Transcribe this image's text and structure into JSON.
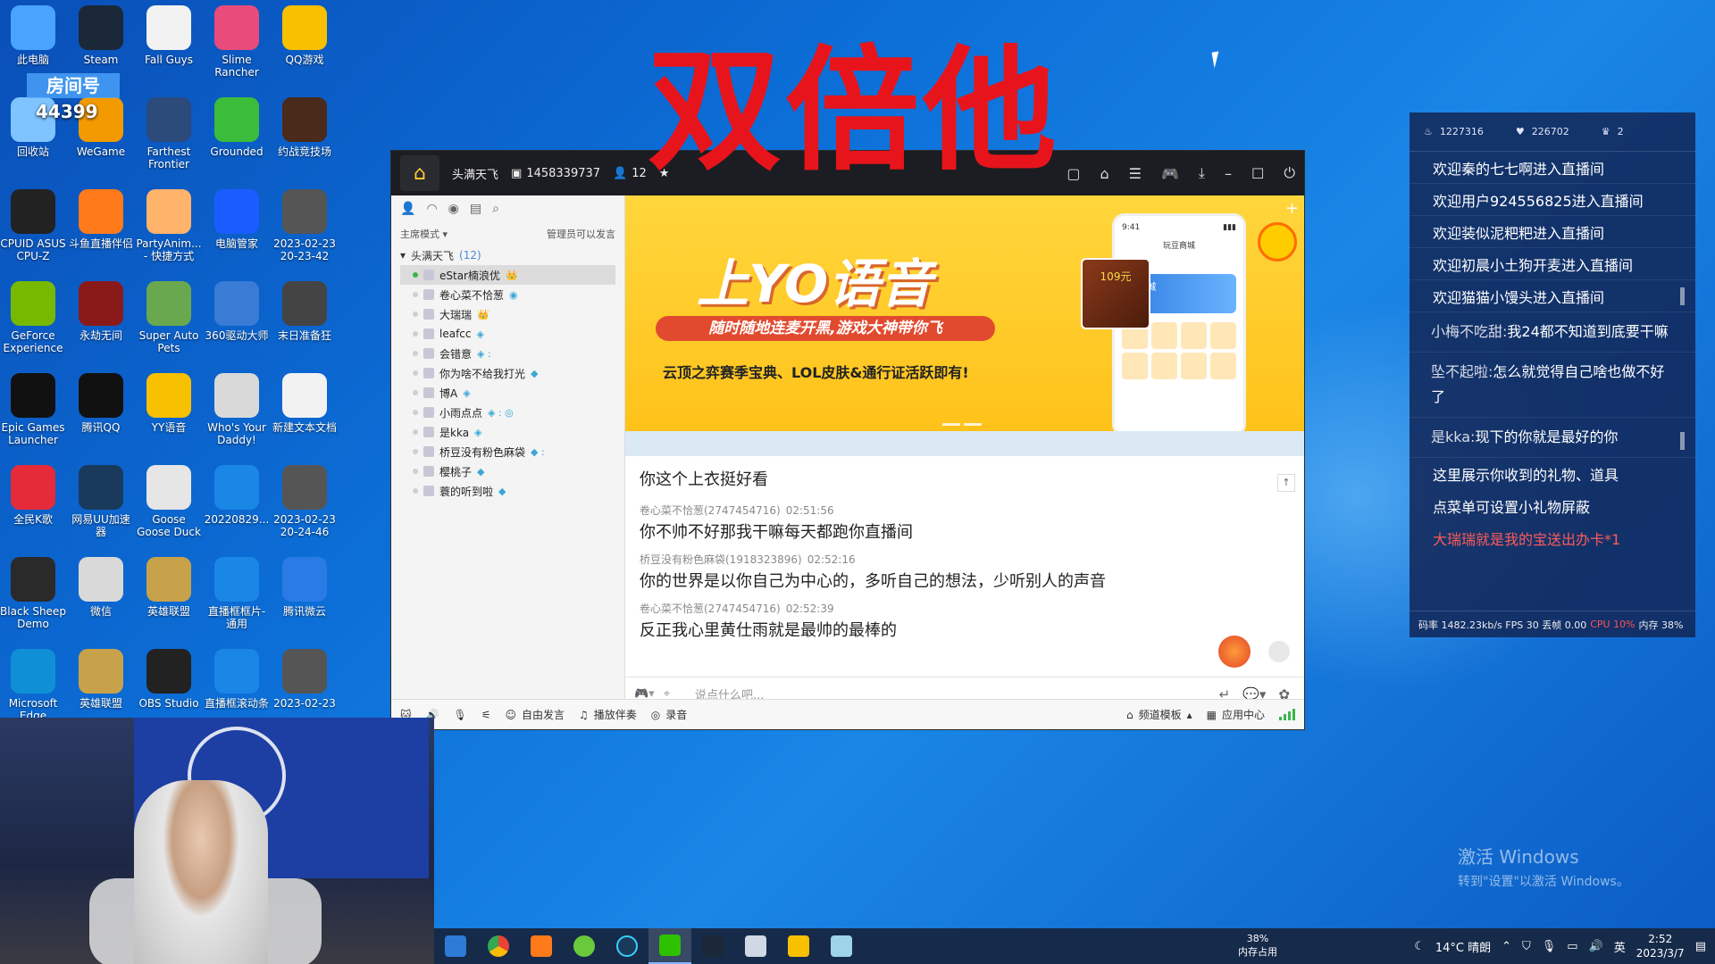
{
  "overlay": {
    "big_text": "双倍他",
    "room_badge": "房间号",
    "room_number": "44399"
  },
  "desktop_icons": [
    {
      "label": "此电脑",
      "color": "#4aa3ff"
    },
    {
      "label": "Steam",
      "color": "#1b2838"
    },
    {
      "label": "Fall Guys",
      "color": "#f2f2f2"
    },
    {
      "label": "Slime Rancher",
      "color": "#e94b7a"
    },
    {
      "label": "QQ游戏",
      "color": "#f7c000"
    },
    {
      "label": "回收站",
      "color": "#7fc3ff"
    },
    {
      "label": "WeGame",
      "color": "#f29a00"
    },
    {
      "label": "Farthest Frontier",
      "color": "#2c4a7a"
    },
    {
      "label": "Grounded",
      "color": "#3bbd3b"
    },
    {
      "label": "约战竞技场",
      "color": "#4a2a1a"
    },
    {
      "label": "CPUID ASUS CPU-Z",
      "color": "#222222"
    },
    {
      "label": "斗鱼直播伴侣",
      "color": "#ff7a1a"
    },
    {
      "label": "PartyAnim... - 快捷方式",
      "color": "#ffb36b"
    },
    {
      "label": "电脑管家",
      "color": "#1a5cff"
    },
    {
      "label": "2023-02-23 20-23-42",
      "color": "#555555"
    },
    {
      "label": "GeForce Experience",
      "color": "#76b900"
    },
    {
      "label": "永劫无间",
      "color": "#8a1a1a"
    },
    {
      "label": "Super Auto Pets",
      "color": "#6aa84f"
    },
    {
      "label": "360驱动大师",
      "color": "#3a7bd5"
    },
    {
      "label": "末日准备狂",
      "color": "#444444"
    },
    {
      "label": "Epic Games Launcher",
      "color": "#111111"
    },
    {
      "label": "腾讯QQ",
      "color": "#111111"
    },
    {
      "label": "YY语音",
      "color": "#f7c000"
    },
    {
      "label": "Who's Your Daddy!",
      "color": "#d9d9d9"
    },
    {
      "label": "新建文本文档",
      "color": "#f2f2f2"
    },
    {
      "label": "全民K歌",
      "color": "#e52b3a"
    },
    {
      "label": "网易UU加速器",
      "color": "#1a3a5c"
    },
    {
      "label": "Goose Goose Duck",
      "color": "#e6e6e6"
    },
    {
      "label": "20220829...",
      "color": "#1a86e6"
    },
    {
      "label": "2023-02-23 20-24-46",
      "color": "#555555"
    },
    {
      "label": "Black Sheep Demo",
      "color": "#2a2a2a"
    },
    {
      "label": "微信",
      "color": "#d9d9d9"
    },
    {
      "label": "英雄联盟",
      "color": "#c8a24a"
    },
    {
      "label": "直播框框片-通用",
      "color": "#1a86e6"
    },
    {
      "label": "腾讯微云",
      "color": "#2a7be6"
    },
    {
      "label": "Microsoft Edge",
      "color": "#0f8fd6"
    },
    {
      "label": "英雄联盟",
      "color": "#c8a24a"
    },
    {
      "label": "OBS Studio",
      "color": "#222222"
    },
    {
      "label": "直播框滚动条",
      "color": "#1a86e6"
    },
    {
      "label": "2023-02-23",
      "color": "#555555"
    }
  ],
  "yy": {
    "channel_name": "头满天飞",
    "channel_id": "1458339737",
    "online": "12",
    "mode": "主席模式",
    "permission": "管理员可以发言",
    "tree_title": "头满天飞",
    "tree_count": "(12)",
    "members": [
      {
        "name": "eStar楠浪优",
        "online": true,
        "selected": true,
        "badge": "👑"
      },
      {
        "name": "卷心菜不恰葱",
        "online": false,
        "selected": false,
        "badge": "◉"
      },
      {
        "name": "大瑞瑞",
        "online": false,
        "selected": false,
        "badge": "👑"
      },
      {
        "name": "leafcc",
        "online": false,
        "selected": false,
        "badge": "◈"
      },
      {
        "name": "会错意",
        "online": false,
        "selected": false,
        "badge": "◈ :"
      },
      {
        "name": "你为啥不给我打光",
        "online": false,
        "selected": false,
        "badge": "◆"
      },
      {
        "name": "博A",
        "online": false,
        "selected": false,
        "badge": "◈"
      },
      {
        "name": "小雨点点",
        "online": false,
        "selected": false,
        "badge": "◈ : ◎"
      },
      {
        "name": "是kka",
        "online": false,
        "selected": false,
        "badge": "◈"
      },
      {
        "name": "桥豆没有粉色麻袋",
        "online": false,
        "selected": false,
        "badge": "◆ :"
      },
      {
        "name": "樱桃子",
        "online": false,
        "selected": false,
        "badge": "◆"
      },
      {
        "name": "蓑的听到啦",
        "online": false,
        "selected": false,
        "badge": "◆"
      }
    ],
    "banner": {
      "title": "上YO语音",
      "pill": "随时随地连麦开黑,游戏大神带你飞",
      "sub": "云顶之弈赛季宝典、LOL皮肤&通行证活跃即有!",
      "phone_time": "9:41",
      "phone_title": "玩豆商城",
      "phone_card": "YY商城",
      "box_label": "109元"
    },
    "chat_first": "你这个上衣挺好看",
    "messages": [
      {
        "user": "卷心菜不恰葱(2747454716)",
        "time": "02:51:56",
        "text": "你不帅不好那我干嘛每天都跑你直播间"
      },
      {
        "user": "桥豆没有粉色麻袋(1918323896)",
        "time": "02:52:16",
        "text": "你的世界是以你自己为中心的，多听自己的想法，少听别人的声音"
      },
      {
        "user": "卷心菜不恰葱(2747454716)",
        "time": "02:52:39",
        "text": "反正我心里黄仕雨就是最帅的最棒的"
      }
    ],
    "input_placeholder": "说点什么吧...",
    "bottom": {
      "free_speak": "自由发言",
      "play_music": "播放伴奏",
      "record": "录音",
      "channel_template": "频道模板",
      "app_center": "应用中心"
    }
  },
  "live": {
    "stat_fire": "1227316",
    "stat_heart": "226702",
    "stat_crown": "2",
    "enters": [
      "欢迎秦的七七啊进入直播间",
      "欢迎用户924556825进入直播间",
      "欢迎装似泥粑粑进入直播间",
      "欢迎初晨小土狗开麦进入直播间",
      "欢迎猫猫小馒头进入直播间"
    ],
    "chats": [
      {
        "user": "小梅不吃甜:",
        "text": "我24都不知道到底要干嘛"
      },
      {
        "user": "坠不起啦:",
        "text": "怎么就觉得自己啥也做不好了"
      },
      {
        "user": "是kka:",
        "text": "现下的你就是最好的你"
      }
    ],
    "sys1": "这里展示你收到的礼物、道具",
    "sys2": "点菜单可设置小礼物屏蔽",
    "gift": "大瑞瑞就是我的宝送出办卡*1",
    "foot_rate": "码率 1482.23kb/s FPS 30 丢帧 0.00",
    "foot_cpu": "CPU 10%",
    "foot_mem": "内存 38%"
  },
  "taskbar": {
    "mem_pct": "38%",
    "mem_label": "内存占用",
    "weather": "14°C 晴朗",
    "lang": "英",
    "time": "2:52",
    "date": "2023/3/7"
  },
  "activation": {
    "line1": "激活 Windows",
    "line2": "转到\"设置\"以激活 Windows。"
  }
}
